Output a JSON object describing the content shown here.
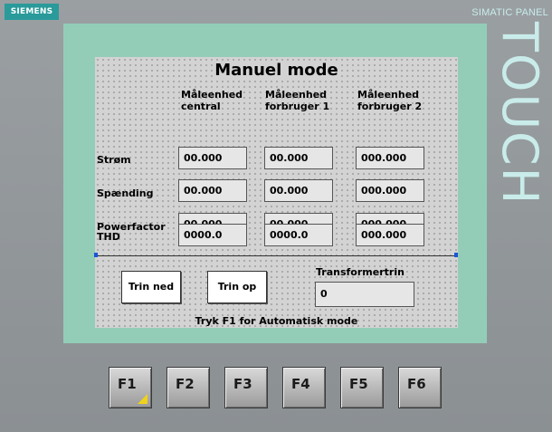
{
  "device": {
    "brand": "SIEMENS",
    "panel_label": "SIMATIC PANEL",
    "touch_label": "TOUCH"
  },
  "screen": {
    "title": "Manuel mode",
    "columns": [
      {
        "line1": "Måleenhed",
        "line2": "central"
      },
      {
        "line1": "Måleenhed",
        "line2": "forbruger 1"
      },
      {
        "line1": "Måleenhed",
        "line2": "forbruger 2"
      }
    ],
    "rows": [
      {
        "label": "Strøm",
        "values": [
          "00.000",
          "00.000",
          "000.000"
        ]
      },
      {
        "label": "Spænding",
        "values": [
          "00.000",
          "00.000",
          "000.000"
        ]
      },
      {
        "label": "Powerfactor",
        "values": [
          "00.000",
          "00.000",
          "000.000"
        ]
      },
      {
        "label": "THD",
        "values": [
          "0000.0",
          "0000.0",
          "000.000"
        ]
      }
    ],
    "buttons": {
      "down": "Trin ned",
      "up": "Trin op"
    },
    "transformer": {
      "label": "Transformertrin",
      "value": "0"
    },
    "footer": "Tryk F1 for Automatisk mode"
  },
  "function_keys": [
    "F1",
    "F2",
    "F3",
    "F4",
    "F5",
    "F6"
  ],
  "colors": {
    "bezel": "#8e9396",
    "screen_bg": "#93cdb8",
    "canvas_bg": "#d3d3d3",
    "brand_bg": "#2a9a9a",
    "f1_marker": "#f0d21a"
  }
}
